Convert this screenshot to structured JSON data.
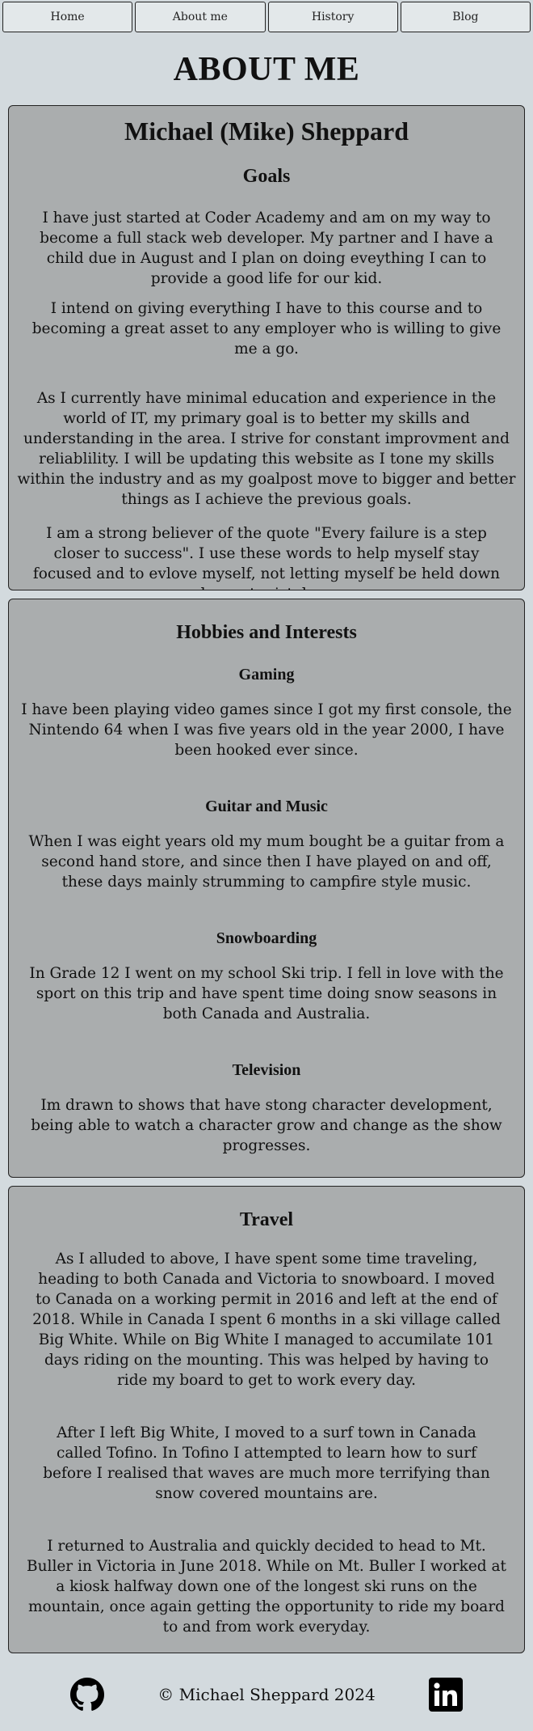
{
  "nav": {
    "items": [
      {
        "label": "Home"
      },
      {
        "label": "About me"
      },
      {
        "label": "History"
      },
      {
        "label": "Blog"
      }
    ]
  },
  "page": {
    "title": "ABOUT ME"
  },
  "goals_card": {
    "name": "Michael (Mike) Sheppard",
    "heading": "Goals",
    "paragraphs": [
      "I have just started at Coder Academy and am on my way to become a full stack web developer. My partner and I have a child due in August and I plan on doing eveything I can to provide a good life for our kid.",
      "I intend on giving everything I have to this course and to becoming a great asset to any employer who is willing to give me a go.",
      "As I currently have minimal education and experience in the world of IT, my primary goal is to better my skills and understanding in the area. I strive for constant improvment and reliablility. I will be updating this website as I tone my skills within the industry and as my goalpost move to bigger and better things as I achieve the previous goals.",
      "I am a strong believer of the quote \"Every failure is a step closer to success\". I use these words to help myself stay focused and to evlove myself, not letting myself be held down by past mistakes."
    ]
  },
  "hobbies_card": {
    "heading": "Hobbies and Interests",
    "items": [
      {
        "title": "Gaming",
        "text": "I have been playing video games since I got my first console, the Nintendo 64 when I was five years old in the year 2000, I have been hooked ever since."
      },
      {
        "title": "Guitar and Music",
        "text": "When I was eight years old my mum bought be a guitar from a second hand store, and since then I have played on and off, these days mainly strumming to campfire style music."
      },
      {
        "title": "Snowboarding",
        "text": "In Grade 12 I went on my school Ski trip. I fell in love with the sport on this trip and have spent time doing snow seasons in both Canada and Australia."
      },
      {
        "title": "Television",
        "text": "Im drawn to shows that have stong character development, being able to watch a character grow and change as the show progresses."
      }
    ]
  },
  "travel_card": {
    "heading": "Travel",
    "paragraphs": [
      "As I alluded to above, I have spent some time traveling, heading to both Canada and Victoria to snowboard. I moved to Canada on a working permit in 2016 and left at the end of 2018. While in Canada I spent 6 months in a ski village called Big White. While on Big White I managed to accumilate 101 days riding on the mounting. This was helped by having to ride my board to get to work every day.",
      "After I left Big White, I moved to a surf town in Canada called Tofino. In Tofino I attempted to learn how to surf before I realised that waves are much more terrifying than snow covered mountains are.",
      "I returned to Australia and quickly decided to head to Mt. Buller in Victoria in June 2018. While on Mt. Buller I worked at a kiosk halfway down one of the longest ski runs on the mountain, once again getting the opportunity to ride my board to and from work everyday."
    ]
  },
  "footer": {
    "copyright": "© Michael Sheppard 2024",
    "icons": [
      "github-icon",
      "linkedin-icon"
    ]
  },
  "colors": {
    "background": "#d3dade",
    "card": "#aaadae",
    "nav_button": "#e3e8ea"
  }
}
